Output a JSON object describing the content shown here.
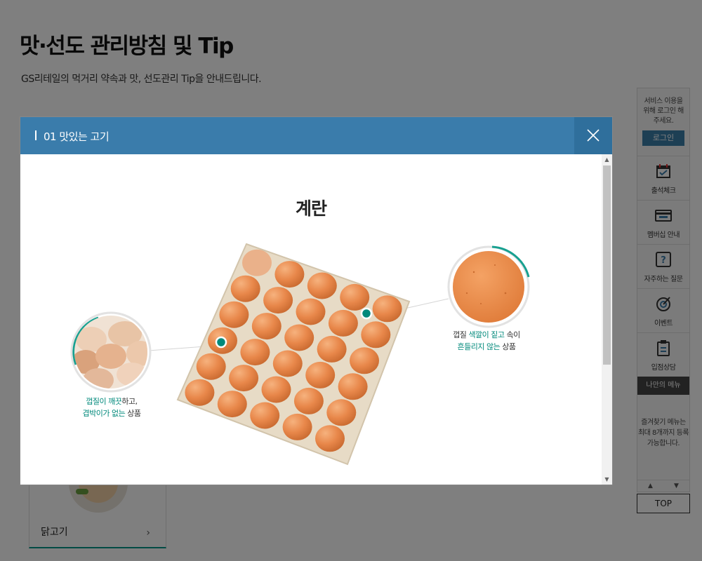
{
  "page": {
    "title": "맛·선도 관리방침 및 Tip",
    "description": "GS리테일의 먹거리 약속과 맛, 선도관리 Tip을 안내드립니다.",
    "card": {
      "label": "닭고기",
      "arrow": "›"
    }
  },
  "quick_menu": {
    "login_message": "서비스 이용을 위해 로그인 해주세요.",
    "login_button": "로그인",
    "items": [
      {
        "label": "출석체크",
        "icon": "calendar-check-icon"
      },
      {
        "label": "멤버십 안내",
        "icon": "membership-card-icon"
      },
      {
        "label": "자주하는 질문",
        "icon": "question-icon"
      },
      {
        "label": "이벤트",
        "icon": "target-icon"
      },
      {
        "label": "입점상담",
        "icon": "clipboard-icon"
      }
    ],
    "my_menu_title": "나만의 메뉴",
    "my_menu_desc": "즐겨찾기 메뉴는 최대 8개까지 등록 가능합니다.",
    "scroll_up": "▲",
    "scroll_down": "▼",
    "top_button": "TOP"
  },
  "modal": {
    "title": "01 맛있는 고기",
    "close_label": "×",
    "heading": "계란",
    "left_caption": {
      "line1_highlight": "껍질이 깨끗",
      "line1_rest": "하고,",
      "line2_highlight": "겹박이가 없는",
      "line2_rest": " 상품"
    },
    "right_caption": {
      "line1_prefix": "껍질 ",
      "line1_highlight": "색깔이 짙고",
      "line1_rest": " 속이",
      "line2_highlight": "흔들리지 않는",
      "line2_rest": " 상품"
    },
    "scroll_up": "▲",
    "scroll_down": "▼"
  },
  "colors": {
    "header": "#3a7cab",
    "accent": "#00897b",
    "egg": "#e9884a",
    "tray": "#e8dcc8"
  }
}
